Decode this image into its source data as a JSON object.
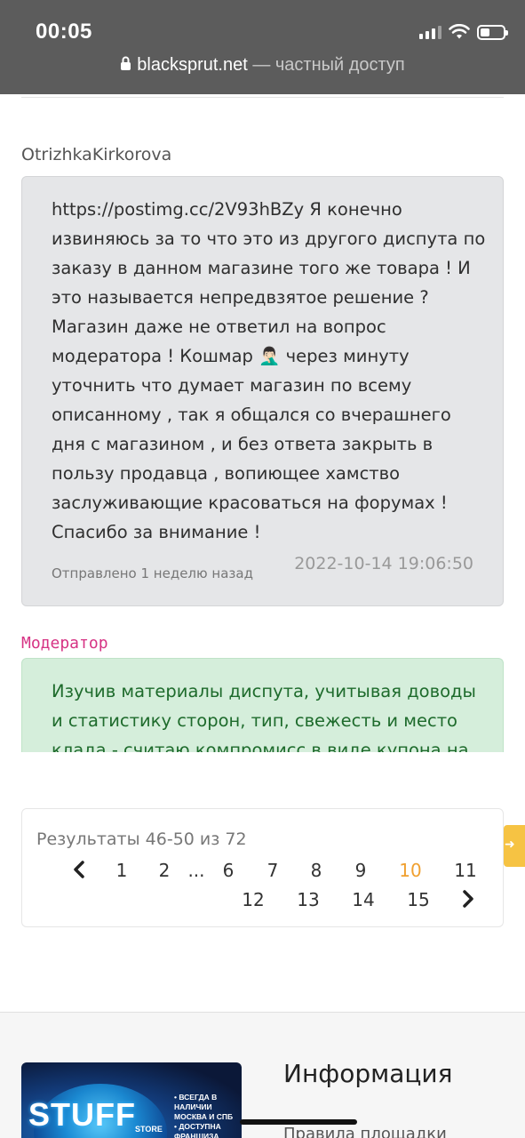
{
  "status_bar": {
    "time": "00:05"
  },
  "browser": {
    "domain": "blacksprut.net",
    "suffix": " — частный доступ"
  },
  "user_message": {
    "author": "OtrizhkaKirkorova",
    "text": "https://postimg.cc/2V93hBZy Я конечно\nизвиняюсь за то что это из другого диспута по\nзаказу в данном магазине того же товара ! И\nэто называется непредвзятое решение ?\nМагазин даже не ответил на вопрос\nмодератора ! Кошмар 🤦🏻‍♂️ через минуту\nуточнить что думает магазин по всему\nописанному , так я общался со вчерашнего\nдня с магазином , и без ответа закрыть в\nпользу продавца , вопиющее хамство\nзаслуживающие красоваться на форумах !\nСпасибо за внимание !",
    "sent_ago": "Отправлено 1 неделю назад",
    "sent_date": "2022-10-14 19:06:50"
  },
  "moderator_message": {
    "label": "Модератор",
    "text": "Изучив материалы диспута, учитывая доводы и статистику сторон, тип, свежесть и место клада - считаю компромисс в виде купона на"
  },
  "pagination": {
    "results_text": "Результаты 46-50 из 72",
    "pages_row1": [
      "1",
      "2",
      "...",
      "6",
      "7",
      "8",
      "9",
      "10",
      "11"
    ],
    "pages_row2": [
      "12",
      "13",
      "14",
      "15"
    ],
    "current_page": "10",
    "prev_icon": "chevron-left-icon",
    "next_icon": "chevron-right-icon"
  },
  "footer": {
    "banner": {
      "brand": "STUFF",
      "store": "STORE",
      "lines": [
        "ВСЕГДА В НАЛИЧИИ МОСКВА И СПБ",
        "ДОСТУПНА ФРАНШИЗА"
      ]
    },
    "info_title": "Информация",
    "info_link": "Правила площадки"
  },
  "colors": {
    "status_bar_bg": "#5c5c5c",
    "user_bubble": "#e5e6e8",
    "moderator_bubble": "#d5eedb",
    "moderator_text": "#1e6b2c",
    "moderator_label": "#d63384",
    "active_page": "#f0a030",
    "side_tab": "#f6c343"
  }
}
